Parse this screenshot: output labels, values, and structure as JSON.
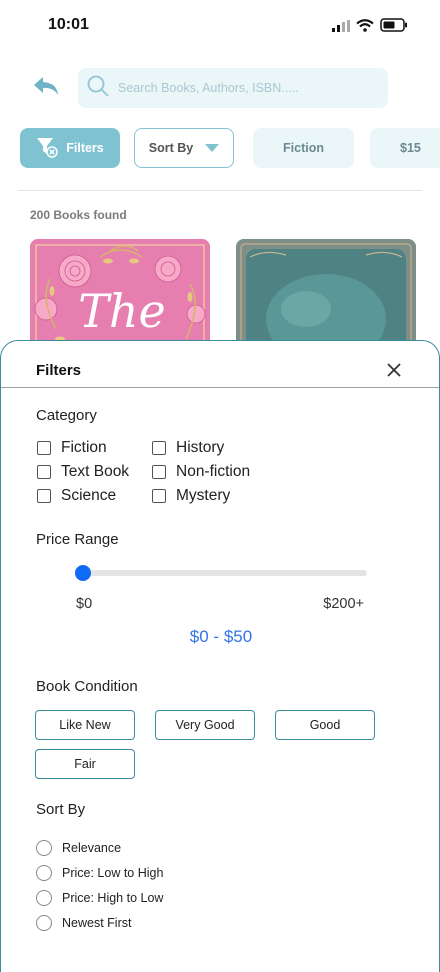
{
  "status_bar": {
    "time": "10:01"
  },
  "search": {
    "placeholder": "Search Books, Authors, ISBN....."
  },
  "chips": {
    "filters_label": "Filters",
    "sort_label": "Sort By",
    "fiction_label": "Fiction",
    "price_label": "$15"
  },
  "results": {
    "count_text": "200 Books found"
  },
  "books": [
    {
      "cover_text": "The",
      "cover_color": "#e67fb0"
    },
    {
      "cover_color": "#7e8f88"
    }
  ],
  "filters_sheet": {
    "title": "Filters",
    "category": {
      "title": "Category",
      "options": [
        "Fiction",
        "Text Book",
        "Science",
        "History",
        "Non-fiction",
        "Mystery"
      ]
    },
    "price_range": {
      "title": "Price Range",
      "min_label": "$0",
      "max_label": "$200+",
      "selected_text": "$0 - $50",
      "slider_fraction": 0.02
    },
    "condition": {
      "title": "Book Condition",
      "options": [
        "Like New",
        "Very Good",
        "Good",
        "Fair"
      ]
    },
    "sort": {
      "title": "Sort By",
      "options": [
        "Relevance",
        "Price: Low to High",
        "Price: High to Low",
        "Newest First"
      ]
    }
  },
  "colors": {
    "accent": "#7fc3d3",
    "border_teal": "#3b8d9d",
    "slider_blue": "#0f6bf5",
    "price_text_blue": "#3273e8"
  }
}
